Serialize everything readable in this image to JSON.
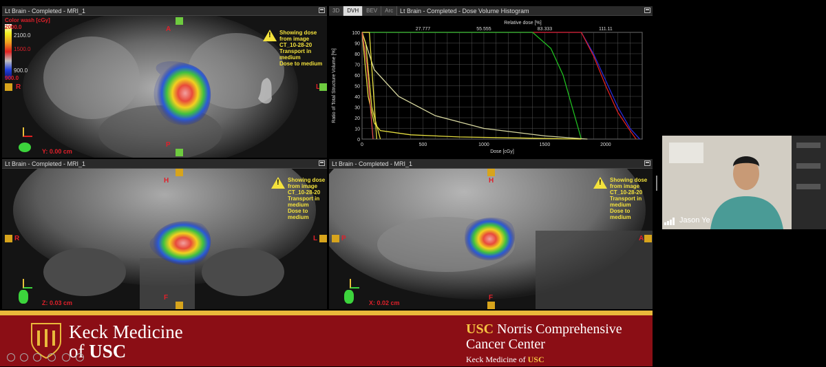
{
  "panes": {
    "axial": {
      "title": "Lt Brain  -  Completed  -  MRI_1",
      "colorwash_label": "Color wash [cGy]",
      "scale_values": [
        "2000.0",
        "2100.0",
        "1500.0",
        "900.0",
        "900.0"
      ],
      "orient": {
        "top": "A",
        "bottom": "P",
        "left": "R",
        "right": "L"
      },
      "coord": "Y: 0.00 cm",
      "warning": [
        "Showing dose",
        "from image",
        "CT_10-28-20",
        "Transport in",
        "medium",
        "Dose to medium"
      ]
    },
    "coronal": {
      "title": "Lt Brain  -  Completed  -  MRI_1",
      "orient": {
        "top": "H",
        "bottom": "F",
        "left": "R",
        "right": "L"
      },
      "coord": "Z: 0.03 cm",
      "warning": [
        "Showing dose",
        "from image",
        "CT_10-28-20",
        "Transport in",
        "medium",
        "Dose to medium"
      ]
    },
    "sagittal": {
      "title": "Lt Brain  -  Completed  -  MRI_1",
      "orient": {
        "top": "H",
        "bottom": "F",
        "left": "P",
        "right": "A"
      },
      "coord": "X: 0.02 cm",
      "warning": [
        "Showing dose",
        "from image",
        "CT_10-28-20",
        "Transport in",
        "medium",
        "Dose to medium"
      ]
    },
    "dvh": {
      "tabs": [
        "3D",
        "DVH",
        "BEV",
        "Arc"
      ],
      "active_tab": "DVH",
      "title": "Lt Brain  -  Completed  -  Dose Volume Histogram"
    }
  },
  "chart_data": {
    "type": "line",
    "title": "",
    "xlabel": "Dose [cGy]",
    "ylabel": "Ratio of Total Structure Volume [%]",
    "top_axis_label": "Relative dose [%]",
    "top_ticks": [
      "27.777",
      "55.555",
      "83.333",
      "111.11"
    ],
    "xlim": [
      0,
      2300
    ],
    "ylim": [
      0,
      100
    ],
    "xticks": [
      0,
      500,
      1000,
      1500,
      2000
    ],
    "yticks": [
      0,
      10,
      20,
      30,
      40,
      50,
      60,
      70,
      80,
      90,
      100
    ],
    "grid": true,
    "series": [
      {
        "color": "#2a2ad8",
        "x": [
          0,
          1800,
          1900,
          2000,
          2100,
          2200,
          2280
        ],
        "y": [
          100,
          100,
          80,
          55,
          30,
          10,
          0
        ]
      },
      {
        "color": "#e02020",
        "x": [
          0,
          1800,
          1900,
          2000,
          2100,
          2200,
          2250
        ],
        "y": [
          100,
          100,
          78,
          50,
          25,
          8,
          0
        ]
      },
      {
        "color": "#20c020",
        "x": [
          0,
          1400,
          1550,
          1650,
          1750,
          1800
        ],
        "y": [
          100,
          100,
          85,
          60,
          20,
          0
        ]
      },
      {
        "color": "#d8d8a0",
        "x": [
          0,
          100,
          300,
          600,
          1000,
          1500,
          1850
        ],
        "y": [
          100,
          65,
          40,
          22,
          10,
          3,
          0
        ]
      },
      {
        "color": "#e8e040",
        "x": [
          0,
          50,
          100,
          150,
          400,
          800,
          1800
        ],
        "y": [
          100,
          40,
          15,
          8,
          4,
          2,
          0
        ]
      },
      {
        "color": "#e8e040",
        "x": [
          0,
          60,
          120
        ],
        "y": [
          100,
          100,
          0
        ]
      },
      {
        "color": "#e8e040",
        "x": [
          0,
          30,
          80,
          150
        ],
        "y": [
          100,
          90,
          30,
          0
        ]
      },
      {
        "color": "#e05050",
        "x": [
          0,
          40,
          90
        ],
        "y": [
          100,
          70,
          0
        ]
      }
    ]
  },
  "video": {
    "name": "Jason Ye"
  },
  "banner": {
    "keck_line1": "Keck Medicine",
    "keck_line2_prefix": "of ",
    "keck_line2_usc": "USC",
    "norris_usc": "USC",
    "norris_line1": " Norris Comprehensive",
    "norris_line2": "Cancer Center",
    "norris_sub_prefix": "Keck Medicine of ",
    "norris_sub_usc": "USC"
  },
  "colors": {
    "banner": "#8b0e15",
    "gold": "#e9b93b",
    "warning": "#f4e23c"
  }
}
